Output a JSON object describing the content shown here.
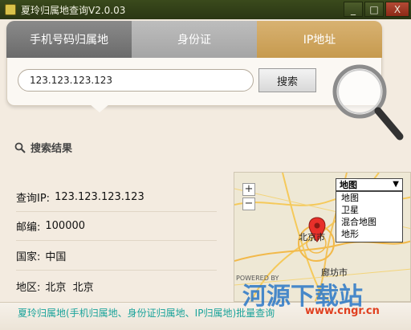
{
  "window": {
    "title": "夏玲归属地查询V2.0.03",
    "minimize": "_",
    "maximize": "□",
    "close": "X"
  },
  "tabs": [
    {
      "label": "手机号码归属地"
    },
    {
      "label": "身份证"
    },
    {
      "label": "IP地址",
      "active": true
    }
  ],
  "search": {
    "value": "123.123.123.123",
    "button_label": "搜索"
  },
  "results": {
    "heading": "搜索结果",
    "rows": [
      {
        "label": "查询IP:",
        "value": "123.123.123.123"
      },
      {
        "label": "邮编:",
        "value": "100000"
      },
      {
        "label": "国家:",
        "value": "中国"
      },
      {
        "label": "地区:",
        "value": "北京  北京"
      }
    ]
  },
  "map": {
    "selected": "地图",
    "options": [
      "地图",
      "卫星",
      "混合地图",
      "地形"
    ],
    "zoom_in": "+",
    "zoom_out": "−",
    "cities": {
      "beijing": "北京市",
      "langfang": "廊坊市"
    },
    "powered_by": "POWERED BY"
  },
  "footer": {
    "text": "夏玲归属地(手机归属地、身份证归属地、IP归属地)批量查询"
  },
  "watermark": {
    "text": "河源下载站",
    "url": "www.cngr.cn"
  },
  "colors": {
    "titlebar": "#2f3d18",
    "active_tab": "#c9a05a",
    "footer_text": "#1aa39a"
  }
}
